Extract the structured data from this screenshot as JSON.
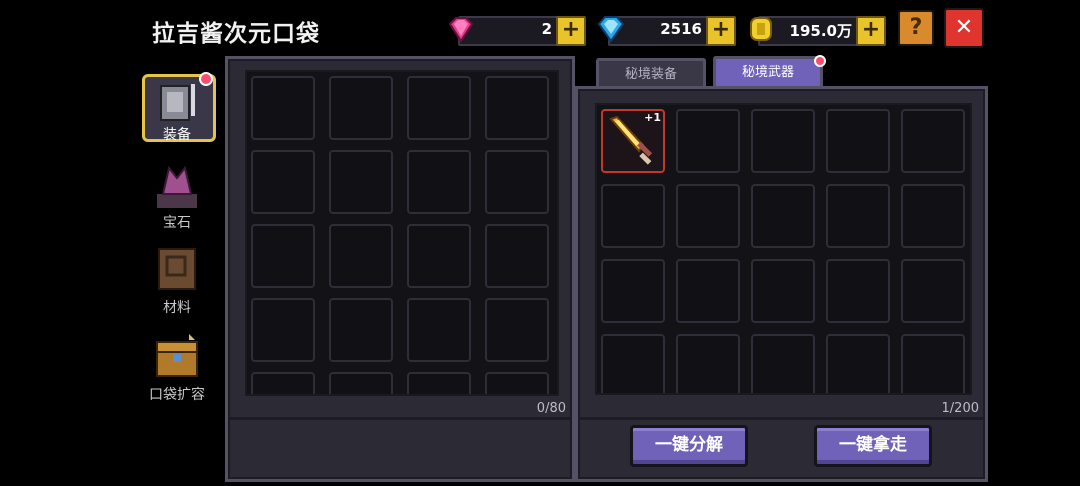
{
  "header": {
    "title": "拉吉酱次元口袋",
    "currencies": [
      {
        "icon": "pink-gem-icon",
        "value": "2"
      },
      {
        "icon": "blue-diamond-icon",
        "value": "2516"
      },
      {
        "icon": "gold-coin-icon",
        "value": "195.0万"
      }
    ],
    "help_label": "?",
    "close_label": "✕"
  },
  "sidebar": {
    "items": [
      {
        "label": "装备",
        "icon": "armor-icon",
        "selected": true
      },
      {
        "label": "宝石",
        "icon": "gem-altar-icon"
      },
      {
        "label": "材料",
        "icon": "material-book-icon"
      },
      {
        "label": "口袋扩容",
        "icon": "chest-expand-icon"
      }
    ]
  },
  "left_panel": {
    "count": "0/80"
  },
  "right_panel": {
    "tabs": [
      {
        "label": "秘境装备",
        "active": false
      },
      {
        "label": "秘境武器",
        "active": true
      }
    ],
    "count": "1/200",
    "item": {
      "icon": "golden-sword-icon",
      "badge": "+1"
    },
    "actions": {
      "decompose": "一键分解",
      "take_all": "一键拿走"
    }
  },
  "colors": {
    "accent": "#6f62b8",
    "close": "#e0342f",
    "help": "#d88a2c",
    "plus": "#e8c32a"
  }
}
